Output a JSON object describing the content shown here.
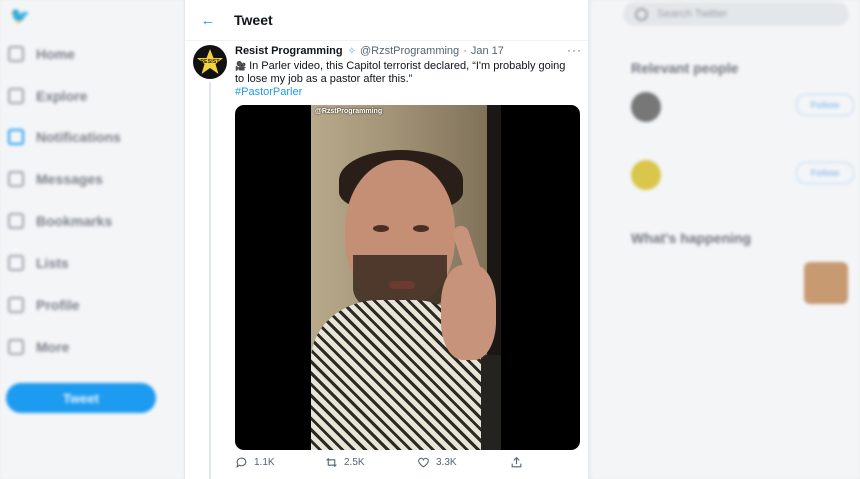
{
  "background": {
    "nav": {
      "items": [
        {
          "label": "Home"
        },
        {
          "label": "Explore"
        },
        {
          "label": "Notifications"
        },
        {
          "label": "Messages"
        },
        {
          "label": "Bookmarks"
        },
        {
          "label": "Lists"
        },
        {
          "label": "Profile"
        },
        {
          "label": "More"
        }
      ],
      "tweet_button": "Tweet"
    },
    "right": {
      "search_placeholder": "Search Twitter",
      "relevant_heading": "Relevant people",
      "whats_happening_heading": "What's happening",
      "follow_label": "Follow"
    }
  },
  "header": {
    "title": "Tweet"
  },
  "tweet": {
    "author": "Resist Programming",
    "handle": "@RzstProgramming",
    "separator": "·",
    "date": "Jan 17",
    "more": "···",
    "text": "In Parler video, this Capitol terrorist declared, “I'm probably going to lose my job as a pastor after this.”",
    "hashtag": "#PastorParler",
    "avatar_text": "RESIST",
    "media": {
      "watermark": "@RzstProgramming"
    },
    "actions": {
      "replies": "1.1K",
      "retweets": "2.5K",
      "likes": "3.3K"
    }
  },
  "colors": {
    "accent": "#1d9bf0",
    "text": "#0f1419",
    "muted": "#536471"
  }
}
